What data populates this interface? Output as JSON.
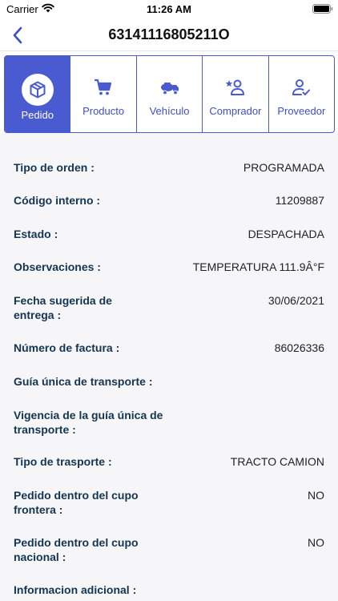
{
  "status_bar": {
    "carrier": "Carrier",
    "time": "11:26 AM"
  },
  "header": {
    "title": "63141116805211O"
  },
  "tabs": [
    {
      "label": "Pedido",
      "icon": "package-icon",
      "active": true
    },
    {
      "label": "Producto",
      "icon": "cart-icon",
      "active": false
    },
    {
      "label": "Vehículo",
      "icon": "truck-icon",
      "active": false
    },
    {
      "label": "Comprador",
      "icon": "buyer-star-icon",
      "active": false
    },
    {
      "label": "Proveedor",
      "icon": "supplier-check-icon",
      "active": false
    }
  ],
  "details": [
    {
      "label": "Tipo de orden :",
      "value": "PROGRAMADA"
    },
    {
      "label": "Código interno :",
      "value": "11209887"
    },
    {
      "label": "Estado :",
      "value": "DESPACHADA"
    },
    {
      "label": "Observaciones :",
      "value": "TEMPERATURA 111.9Â°F"
    },
    {
      "label": "Fecha sugerida de entrega :",
      "value": "30/06/2021"
    },
    {
      "label": "Número de factura :",
      "value": "86026336"
    },
    {
      "label": "Guía única de transporte :",
      "value": ""
    },
    {
      "label": "Vigencia de la guía única de transporte :",
      "value": ""
    },
    {
      "label": "Tipo de trasporte :",
      "value": "TRACTO CAMION"
    },
    {
      "label": "Pedido dentro del cupo frontera :",
      "value": "NO"
    },
    {
      "label": "Pedido dentro del cupo nacional :",
      "value": "NO"
    },
    {
      "label": "Informacion adicional  :",
      "value": ""
    }
  ],
  "colors": {
    "accent": "#4a5ad0",
    "label_text": "#143552",
    "background": "#f6f6f8"
  }
}
